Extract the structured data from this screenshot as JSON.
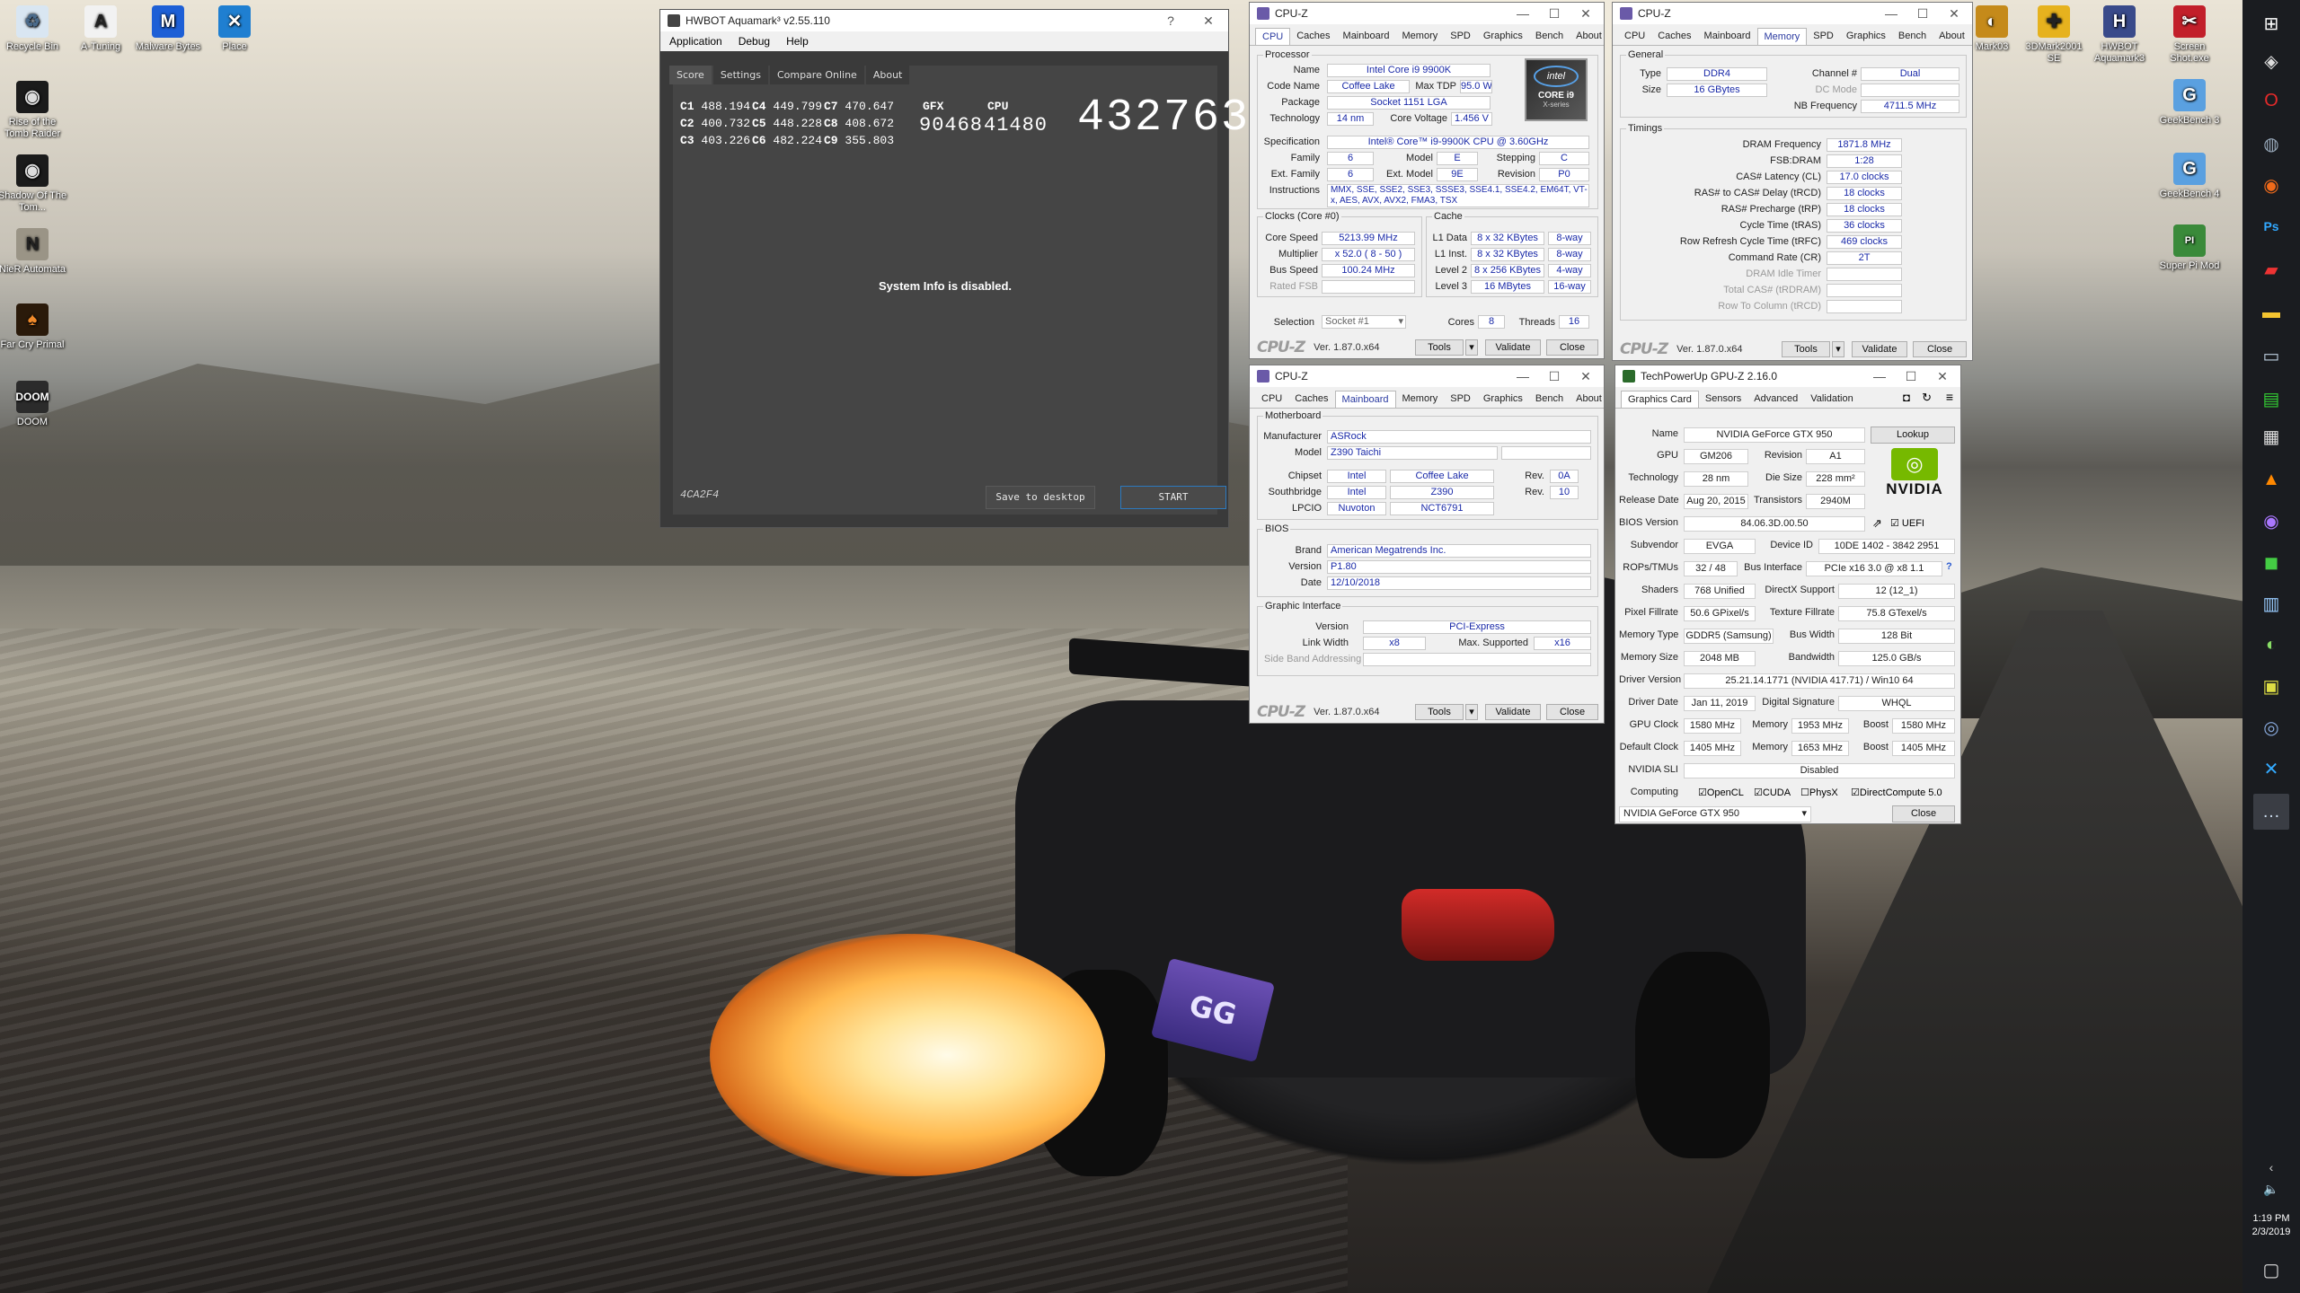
{
  "desktop": {
    "left_icons": [
      {
        "label": "Recycle Bin",
        "icon": "recycle-bin-icon"
      },
      {
        "label": "A-Tuning",
        "icon": "a-tuning-icon"
      },
      {
        "label": "Malware Bytes",
        "icon": "malwarebytes-icon"
      },
      {
        "label": "Place",
        "icon": "place-icon"
      },
      {
        "label": "Rise of the Tomb Raider",
        "icon": "tomb-raider-icon"
      },
      {
        "label": "Shadow Of The Tom...",
        "icon": "shadow-tomb-raider-icon"
      },
      {
        "label": "NieR Automata",
        "icon": "nier-icon"
      },
      {
        "label": "Far Cry Primal",
        "icon": "farcry-icon"
      },
      {
        "label": "DOOM",
        "icon": "doom-icon"
      }
    ],
    "right_icons": [
      {
        "label": "Mark03",
        "icon": "3dmark03-icon"
      },
      {
        "label": "3DMark2001 SE",
        "icon": "3dmark2001-icon"
      },
      {
        "label": "HWBOT Aquamark3",
        "icon": "aquamark-icon"
      },
      {
        "label": "Screen Shot.exe",
        "icon": "screenshot-icon"
      },
      {
        "label": "GeekBench 3",
        "icon": "geekbench3-icon"
      },
      {
        "label": "GeekBench 4",
        "icon": "geekbench4-icon"
      },
      {
        "label": "Super Pi Mod",
        "icon": "superpi-icon"
      }
    ],
    "plate": "GG"
  },
  "taskbar": {
    "time": "1:19 PM",
    "date": "2/3/2019"
  },
  "aquamark": {
    "title": "HWBOT Aquamark³ v2.55.110",
    "menu": [
      "Application",
      "Debug",
      "Help"
    ],
    "tabs": [
      "Score",
      "Settings",
      "Compare Online",
      "About"
    ],
    "scores": [
      {
        "k": "C1",
        "v": "488.194"
      },
      {
        "k": "C4",
        "v": "449.799"
      },
      {
        "k": "C7",
        "v": "470.647"
      },
      {
        "k": "C2",
        "v": "400.732"
      },
      {
        "k": "C5",
        "v": "448.228"
      },
      {
        "k": "C8",
        "v": "408.672"
      },
      {
        "k": "C3",
        "v": "403.226"
      },
      {
        "k": "C6",
        "v": "482.224"
      },
      {
        "k": "C9",
        "v": "355.803"
      }
    ],
    "gfx_label": "GFX",
    "gfx_value": "90468",
    "cpu_label": "CPU",
    "cpu_value": "41480",
    "total": "432763",
    "sysinfo": "System Info is disabled.",
    "hash": "4CA2F4",
    "save_label": "Save to desktop",
    "start_label": "START"
  },
  "cpuz_cpu": {
    "title": "CPU-Z",
    "tabs": [
      "CPU",
      "Caches",
      "Mainboard",
      "Memory",
      "SPD",
      "Graphics",
      "Bench",
      "About"
    ],
    "processor_legend": "Processor",
    "name_l": "Name",
    "name": "Intel Core i9 9900K",
    "code_l": "Code Name",
    "code": "Coffee Lake",
    "tdp_l": "Max TDP",
    "tdp": "95.0 W",
    "pkg_l": "Package",
    "pkg": "Socket 1151 LGA",
    "tech_l": "Technology",
    "tech": "14 nm",
    "cv_l": "Core Voltage",
    "cv": "1.456 V",
    "spec_l": "Specification",
    "spec": "Intel® Core™ i9-9900K CPU @ 3.60GHz",
    "fam_l": "Family",
    "fam": "6",
    "model_l": "Model",
    "model": "E",
    "step_l": "Stepping",
    "step": "C",
    "efam_l": "Ext. Family",
    "efam": "6",
    "emodel_l": "Ext. Model",
    "emodel": "9E",
    "rev_l": "Revision",
    "rev": "P0",
    "instr_l": "Instructions",
    "instr": "MMX, SSE, SSE2, SSE3, SSSE3, SSE4.1, SSE4.2, EM64T, VT-x, AES, AVX, AVX2, FMA3, TSX",
    "badge_top": "intel",
    "badge_mid": "CORE i9",
    "badge_bot": "X-series",
    "clocks_legend": "Clocks (Core #0)",
    "cs_l": "Core Speed",
    "cs": "5213.99 MHz",
    "mul_l": "Multiplier",
    "mul": "x 52.0 ( 8 - 50 )",
    "bus_l": "Bus Speed",
    "bus": "100.24 MHz",
    "fsb_l": "Rated FSB",
    "fsb": "",
    "cache_legend": "Cache",
    "l1d_l": "L1 Data",
    "l1d": "8 x 32 KBytes",
    "l1d_w": "8-way",
    "l1i_l": "L1 Inst.",
    "l1i": "8 x 32 KBytes",
    "l1i_w": "8-way",
    "l2_l": "Level 2",
    "l2": "8 x 256 KBytes",
    "l2_w": "4-way",
    "l3_l": "Level 3",
    "l3": "16 MBytes",
    "l3_w": "16-way",
    "sel_l": "Selection",
    "sel": "Socket #1",
    "cores_l": "Cores",
    "cores": "8",
    "threads_l": "Threads",
    "threads": "16",
    "logo": "CPU-Z",
    "ver": "Ver. 1.87.0.x64",
    "tools": "Tools",
    "validate": "Validate",
    "close": "Close"
  },
  "cpuz_mem": {
    "title": "CPU-Z",
    "tabs": [
      "CPU",
      "Caches",
      "Mainboard",
      "Memory",
      "SPD",
      "Graphics",
      "Bench",
      "About"
    ],
    "general_legend": "General",
    "type_l": "Type",
    "type": "DDR4",
    "ch_l": "Channel #",
    "ch": "Dual",
    "size_l": "Size",
    "size": "16 GBytes",
    "dc_l": "DC Mode",
    "dc": "",
    "nb_l": "NB Frequency",
    "nb": "4711.5 MHz",
    "timings_legend": "Timings",
    "rows": [
      {
        "l": "DRAM Frequency",
        "v": "1871.8 MHz"
      },
      {
        "l": "FSB:DRAM",
        "v": "1:28"
      },
      {
        "l": "CAS# Latency (CL)",
        "v": "17.0 clocks"
      },
      {
        "l": "RAS# to CAS# Delay (tRCD)",
        "v": "18 clocks"
      },
      {
        "l": "RAS# Precharge (tRP)",
        "v": "18 clocks"
      },
      {
        "l": "Cycle Time (tRAS)",
        "v": "36 clocks"
      },
      {
        "l": "Row Refresh Cycle Time (tRFC)",
        "v": "469 clocks"
      },
      {
        "l": "Command Rate (CR)",
        "v": "2T"
      },
      {
        "l": "DRAM Idle Timer",
        "v": ""
      },
      {
        "l": "Total CAS# (tRDRAM)",
        "v": ""
      },
      {
        "l": "Row To Column (tRCD)",
        "v": ""
      }
    ],
    "logo": "CPU-Z",
    "ver": "Ver. 1.87.0.x64",
    "tools": "Tools",
    "validate": "Validate",
    "close": "Close"
  },
  "cpuz_mb": {
    "title": "CPU-Z",
    "tabs": [
      "CPU",
      "Caches",
      "Mainboard",
      "Memory",
      "SPD",
      "Graphics",
      "Bench",
      "About"
    ],
    "mb_legend": "Motherboard",
    "man_l": "Manufacturer",
    "man": "ASRock",
    "model_l": "Model",
    "model": "Z390 Taichi",
    "chip_l": "Chipset",
    "chip_v": "Intel",
    "chip_n": "Coffee Lake",
    "chip_rl": "Rev.",
    "chip_r": "0A",
    "sb_l": "Southbridge",
    "sb_v": "Intel",
    "sb_n": "Z390",
    "sb_rl": "Rev.",
    "sb_r": "10",
    "lpc_l": "LPCIO",
    "lpc_v": "Nuvoton",
    "lpc_n": "NCT6791",
    "bios_legend": "BIOS",
    "brand_l": "Brand",
    "brand": "American Megatrends Inc.",
    "bver_l": "Version",
    "bver": "P1.80",
    "date_l": "Date",
    "date": "12/10/2018",
    "gi_legend": "Graphic Interface",
    "giver_l": "Version",
    "giver": "PCI-Express",
    "lw_l": "Link Width",
    "lw": "x8",
    "ms_l": "Max. Supported",
    "ms": "x16",
    "sba_l": "Side Band Addressing",
    "logo": "CPU-Z",
    "ver": "Ver. 1.87.0.x64",
    "tools": "Tools",
    "validate": "Validate",
    "close": "Close"
  },
  "gpuz": {
    "title": "TechPowerUp GPU-Z 2.16.0",
    "tabs": [
      "Graphics Card",
      "Sensors",
      "Advanced",
      "Validation"
    ],
    "name_l": "Name",
    "name": "NVIDIA GeForce GTX 950",
    "lookup": "Lookup",
    "gpu_l": "GPU",
    "gpu": "GM206",
    "rev_l": "Revision",
    "rev": "A1",
    "tech_l": "Technology",
    "tech": "28 nm",
    "die_l": "Die Size",
    "die": "228 mm²",
    "rel_l": "Release Date",
    "rel": "Aug 20, 2015",
    "tr_l": "Transistors",
    "tr": "2940M",
    "bios_l": "BIOS Version",
    "bios": "84.06.3D.00.50",
    "uefi": "UEFI",
    "sub_l": "Subvendor",
    "sub": "EVGA",
    "dev_l": "Device ID",
    "dev": "10DE 1402 - 3842 2951",
    "rop_l": "ROPs/TMUs",
    "rop": "32 / 48",
    "bi_l": "Bus Interface",
    "bi": "PCIe x16 3.0 @ x8 1.1",
    "sh_l": "Shaders",
    "sh": "768 Unified",
    "dx_l": "DirectX Support",
    "dx": "12 (12_1)",
    "pf_l": "Pixel Fillrate",
    "pf": "50.6 GPixel/s",
    "tf_l": "Texture Fillrate",
    "tf": "75.8 GTexel/s",
    "mt_l": "Memory Type",
    "mt": "GDDR5 (Samsung)",
    "bw_l": "Bus Width",
    "bw": "128 Bit",
    "ms_l": "Memory Size",
    "ms": "2048 MB",
    "band_l": "Bandwidth",
    "band": "125.0 GB/s",
    "dv_l": "Driver Version",
    "dv": "25.21.14.1771 (NVIDIA 417.71) / Win10 64",
    "dd_l": "Driver Date",
    "dd": "Jan 11, 2019",
    "ds_l": "Digital Signature",
    "ds": "WHQL",
    "gc_l": "GPU Clock",
    "gc": "1580 MHz",
    "mem_l": "Memory",
    "gcm": "1953 MHz",
    "boost_l": "Boost",
    "gcb": "1580 MHz",
    "dc_l": "Default Clock",
    "dc": "1405 MHz",
    "dcm": "1653 MHz",
    "dcb": "1405 MHz",
    "sli_l": "NVIDIA SLI",
    "sli": "Disabled",
    "comp_l": "Computing",
    "c1": "OpenCL",
    "c2": "CUDA",
    "c3": "PhysX",
    "c4": "DirectCompute 5.0",
    "sel": "NVIDIA GeForce GTX 950",
    "close": "Close",
    "nvidia": "NVIDIA"
  }
}
